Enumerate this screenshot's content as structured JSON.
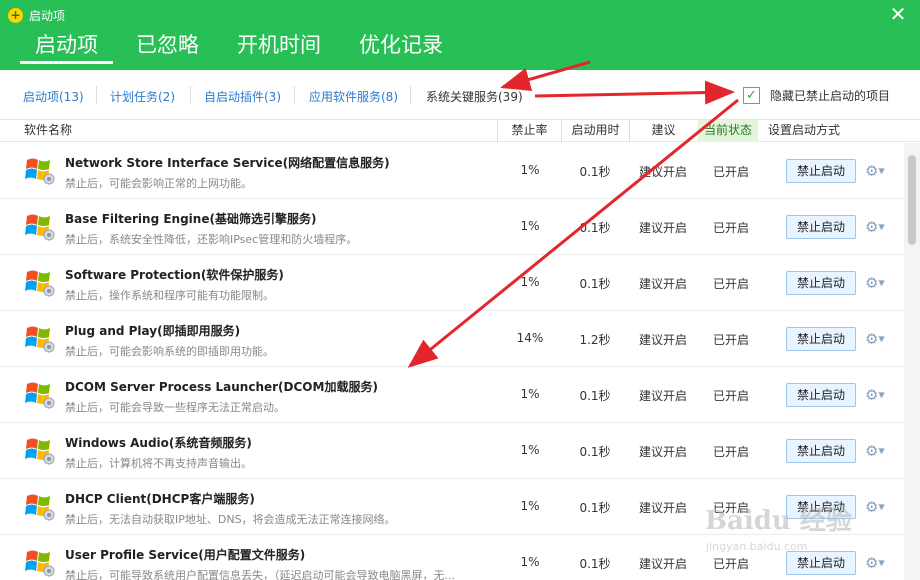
{
  "window": {
    "title": "启动项"
  },
  "main_tabs": [
    {
      "label": "启动项",
      "active": true
    },
    {
      "label": "已忽略",
      "active": false
    },
    {
      "label": "开机时间",
      "active": false
    },
    {
      "label": "优化记录",
      "active": false
    }
  ],
  "sub_tabs": [
    {
      "label": "启动项(13)",
      "active": false
    },
    {
      "label": "计划任务(2)",
      "active": false
    },
    {
      "label": "自启动插件(3)",
      "active": false
    },
    {
      "label": "应用软件服务(8)",
      "active": false
    },
    {
      "label": "系统关键服务(39)",
      "active": true
    }
  ],
  "hide_disabled": {
    "label": "隐藏已禁止启动的项目",
    "checked": true
  },
  "columns": {
    "name": "软件名称",
    "disable_rate": "禁止率",
    "startup_time": "启动用时",
    "suggestion": "建议",
    "current_state": "当前状态",
    "set_startup": "设置启动方式"
  },
  "rows": [
    {
      "name": "Network Store Interface Service(网络配置信息服务)",
      "desc": "禁止后，可能会影响正常的上网功能。",
      "rate": "1%",
      "time": "0.1秒",
      "suggestion": "建议开启",
      "state": "已开启",
      "action": "禁止启动"
    },
    {
      "name": "Base Filtering Engine(基础筛选引擎服务)",
      "desc": "禁止后，系统安全性降低，还影响IPsec管理和防火墙程序。",
      "rate": "1%",
      "time": "0.1秒",
      "suggestion": "建议开启",
      "state": "已开启",
      "action": "禁止启动"
    },
    {
      "name": "Software Protection(软件保护服务)",
      "desc": "禁止后，操作系统和程序可能有功能限制。",
      "rate": "1%",
      "time": "0.1秒",
      "suggestion": "建议开启",
      "state": "已开启",
      "action": "禁止启动"
    },
    {
      "name": "Plug and Play(即插即用服务)",
      "desc": "禁止后，可能会影响系统的即插即用功能。",
      "rate": "14%",
      "time": "1.2秒",
      "suggestion": "建议开启",
      "state": "已开启",
      "action": "禁止启动"
    },
    {
      "name": "DCOM Server Process Launcher(DCOM加载服务)",
      "desc": "禁止后，可能会导致一些程序无法正常启动。",
      "rate": "1%",
      "time": "0.1秒",
      "suggestion": "建议开启",
      "state": "已开启",
      "action": "禁止启动"
    },
    {
      "name": "Windows Audio(系统音频服务)",
      "desc": "禁止后，计算机将不再支持声音输出。",
      "rate": "1%",
      "time": "0.1秒",
      "suggestion": "建议开启",
      "state": "已开启",
      "action": "禁止启动"
    },
    {
      "name": "DHCP Client(DHCP客户端服务)",
      "desc": "禁止后，无法自动获取IP地址、DNS，将会造成无法正常连接网络。",
      "rate": "1%",
      "time": "0.1秒",
      "suggestion": "建议开启",
      "state": "已开启",
      "action": "禁止启动"
    },
    {
      "name": "User Profile Service(用户配置文件服务)",
      "desc": "禁止后，可能导致系统用户配置信息丢失，（延迟启动可能会导致电脑黑屏，无...",
      "rate": "1%",
      "time": "0.1秒",
      "suggestion": "建议开启",
      "state": "已开启",
      "action": "禁止启动"
    }
  ],
  "watermark": {
    "brand": "Baidu 经验",
    "url": "jingyan.baidu.com"
  },
  "colors": {
    "header_green": "#29bf57",
    "link_blue": "#2a7bd0",
    "arrow_red": "#e3262b"
  },
  "icons": {
    "row_icon": "windows-logo-icon",
    "gear": "gear-icon",
    "close": "close-icon",
    "logo": "app-logo-icon"
  }
}
